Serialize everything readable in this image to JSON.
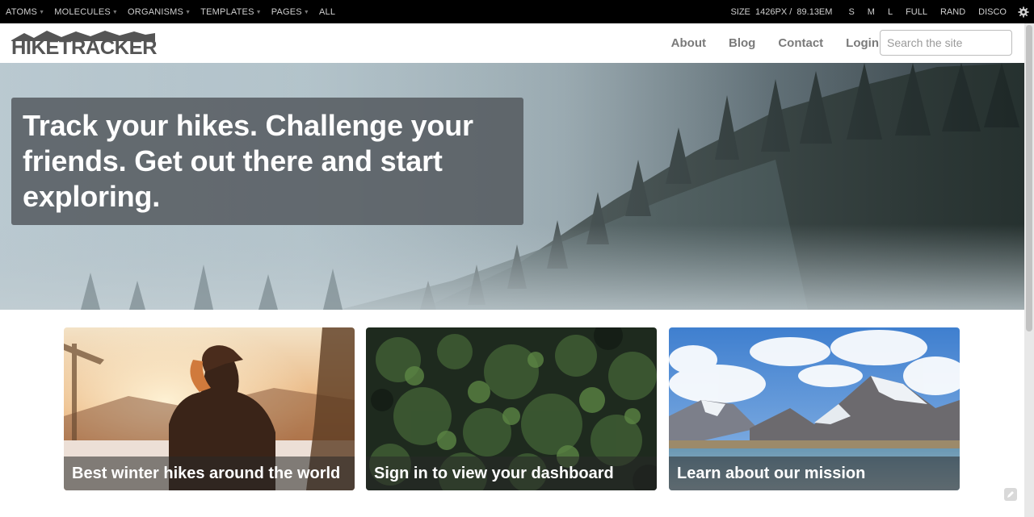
{
  "toolbar": {
    "menu": [
      {
        "label": "ATOMS",
        "caret": true
      },
      {
        "label": "MOLECULES",
        "caret": true
      },
      {
        "label": "ORGANISMS",
        "caret": true
      },
      {
        "label": "TEMPLATES",
        "caret": true
      },
      {
        "label": "PAGES",
        "caret": true
      },
      {
        "label": "ALL",
        "caret": false
      }
    ],
    "size_label": "SIZE",
    "size_px": "1426PX /",
    "size_em": "89.13EM",
    "sizes": [
      "S",
      "M",
      "L",
      "FULL",
      "RAND",
      "DISCO"
    ],
    "settings_icon": "gear-icon"
  },
  "header": {
    "logo_text": "HIKETRACKER",
    "nav": [
      "About",
      "Blog",
      "Contact",
      "Login"
    ],
    "search_placeholder": "Search the site"
  },
  "hero": {
    "title": "Track your hikes. Challenge your friends. Get out there and start exploring."
  },
  "cards": [
    {
      "caption": "Best winter hikes around the world",
      "image": "hiker-sunset-photo"
    },
    {
      "caption": "Sign in to view your dashboard",
      "image": "green-foliage-photo"
    },
    {
      "caption": "Learn about our mission",
      "image": "mountain-lake-photo"
    }
  ],
  "colors": {
    "toolbar_bg": "#000000",
    "nav_text": "#7a7a7a",
    "hero_box": "#50565a",
    "caption_bg": "#282828"
  }
}
